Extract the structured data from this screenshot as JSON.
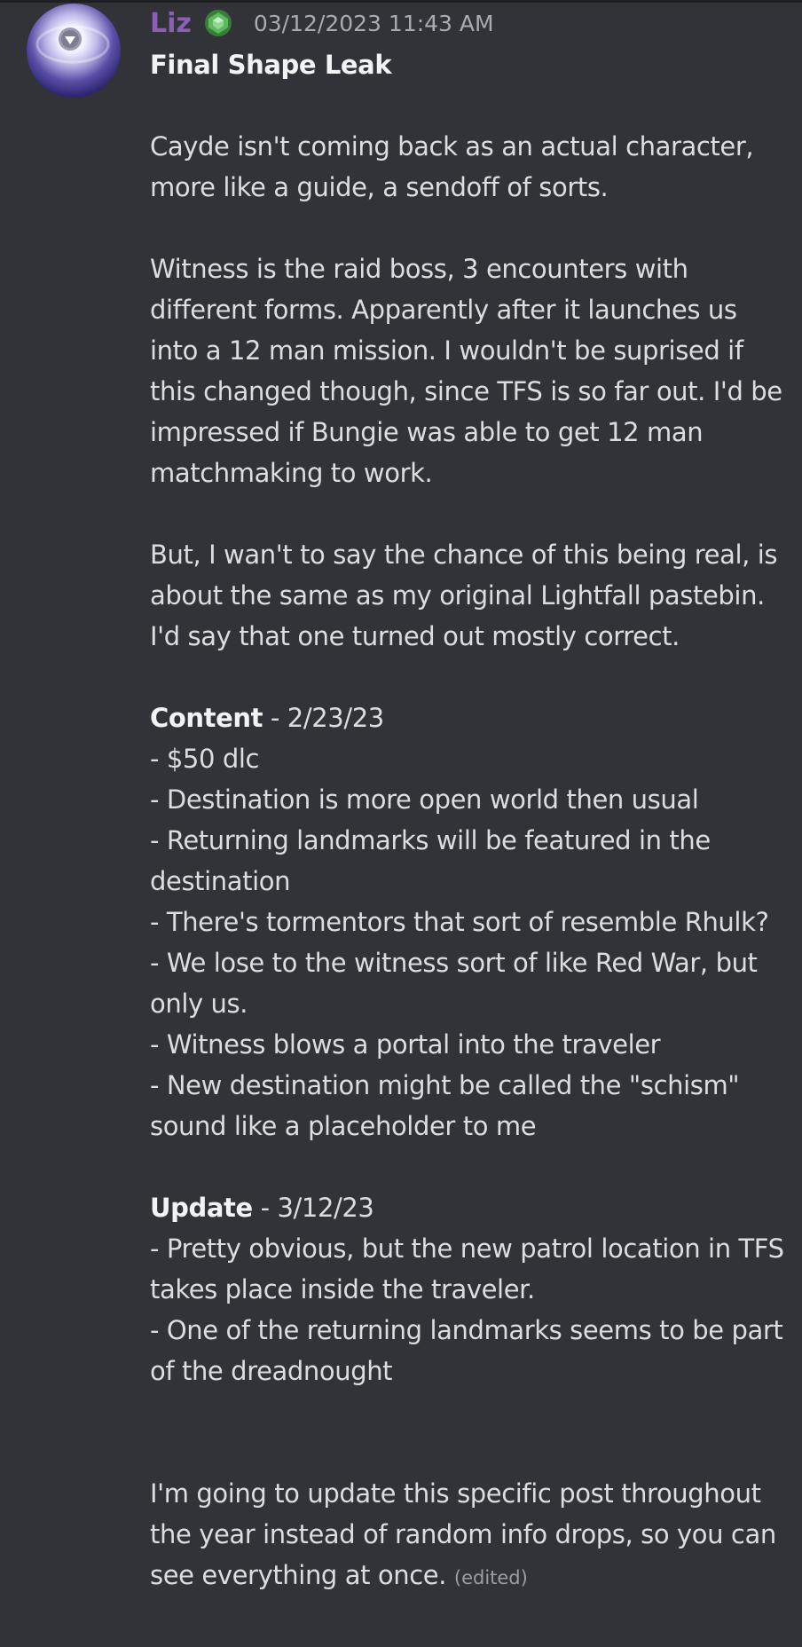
{
  "message": {
    "username": "Liz",
    "timestamp": "03/12/2023 11:43 AM",
    "avatar_icon": "avatar-planet-icon",
    "role_icon": "green-gem-icon",
    "username_color": "#8b5fb5",
    "title": "Final Shape Leak",
    "para1": "Cayde isn't coming back as an actual character, more like a guide, a sendoff of sorts.",
    "para2": "Witness is the raid boss, 3 encounters with different forms. Apparently after it launches us into a 12 man mission. I wouldn't be suprised if this changed though, since TFS is so far out. I'd be impressed if Bungie was able to get 12 man matchmaking to work.",
    "para3": "But, I wan't to say the chance of this being real, is about the same as my original Lightfall pastebin. I'd say that one turned out mostly correct.",
    "content_section": {
      "heading": "Content",
      "date": " - 2/23/23",
      "items": [
        "- $50 dlc",
        "- Destination is more open world then usual",
        "- Returning landmarks will be featured in the destination",
        "- There's tormentors that sort of resemble Rhulk?",
        "- We lose to the witness sort of like Red War, but only us.",
        "- Witness blows a portal into the traveler",
        "- New destination might be called the \"schism\" sound like a placeholder to me"
      ]
    },
    "update_section": {
      "heading": "Update",
      "date": " - 3/12/23",
      "items": [
        "- Pretty obvious, but the new patrol location in TFS takes place inside the traveler.",
        "- One of the returning landmarks seems to be part of the dreadnought"
      ]
    },
    "closing": "I'm going to update this specific post throughout the year instead of random info drops, so you can see everything at once.",
    "edited_label": "(edited)"
  }
}
